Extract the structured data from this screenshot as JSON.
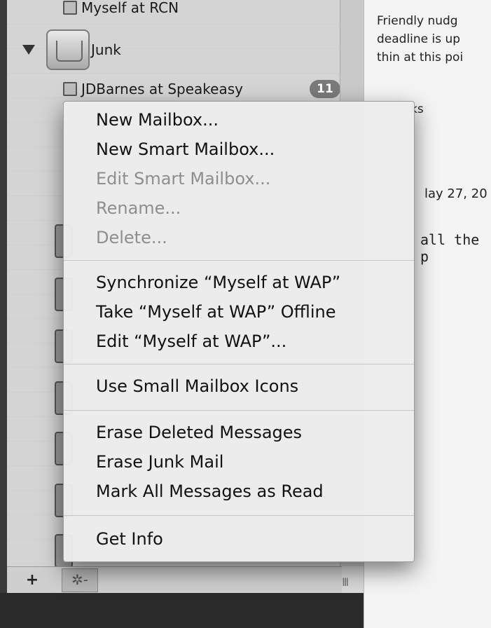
{
  "sidebar": {
    "top_account": "Myself at RCN",
    "junk_label": "Junk",
    "subaccount": "JDBarnes at Speakeasy",
    "badge_count": "11",
    "add_label": "+",
    "action_label": "✲-",
    "resize_label": "III"
  },
  "menu": {
    "items": [
      {
        "label": "New Mailbox...",
        "enabled": true
      },
      {
        "label": "New Smart Mailbox...",
        "enabled": true
      },
      {
        "label": "Edit Smart Mailbox...",
        "enabled": false
      },
      {
        "label": "Rename...",
        "enabled": false
      },
      {
        "label": "Delete...",
        "enabled": false
      },
      {
        "label": "Synchronize “Myself at WAP”",
        "enabled": true
      },
      {
        "label": "Take “Myself at WAP” Offline",
        "enabled": true
      },
      {
        "label": "Edit “Myself at WAP”...",
        "enabled": true
      },
      {
        "label": "Use Small Mailbox Icons",
        "enabled": true
      },
      {
        "label": "Erase Deleted Messages",
        "enabled": true
      },
      {
        "label": "Erase Junk Mail",
        "enabled": true
      },
      {
        "label": "Mark All Messages as Read",
        "enabled": true
      },
      {
        "label": "Get Info",
        "enabled": true
      }
    ]
  },
  "message": {
    "lines": [
      "Friendly nudg",
      "deadline is up",
      "thin at this poi"
    ],
    "thanks": "ks",
    "reply_header": "lay 27, 20",
    "quote": "all the p"
  }
}
